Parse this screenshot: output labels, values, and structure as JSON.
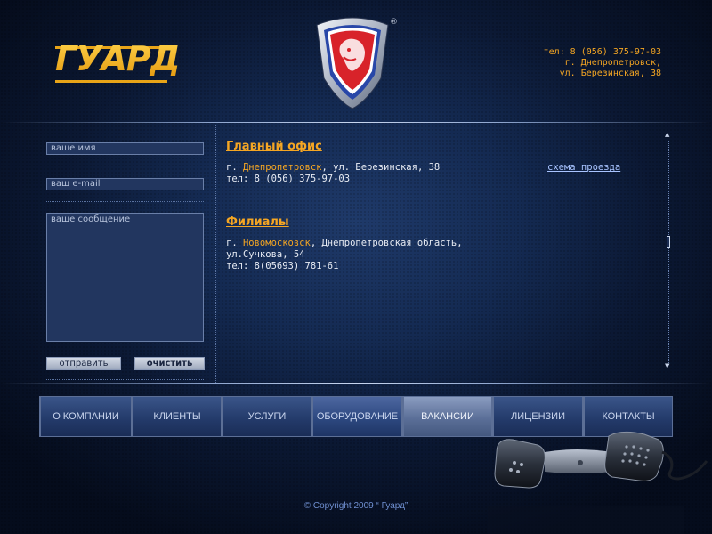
{
  "header": {
    "logo_text": "ГУАРД",
    "registered": "®",
    "contact": {
      "phone": "тел: 8 (056) 375-97-03",
      "city": "г. Днепропетровск,",
      "street": "ул. Березинская, 38"
    }
  },
  "form": {
    "name_placeholder": "ваше имя",
    "email_placeholder": "ваш e-mail",
    "message_placeholder": "ваше сообщение",
    "send_label": "отправить",
    "clear_label": "очистить"
  },
  "content": {
    "main_office": {
      "heading": "Главный офис",
      "city_prefix": "г. ",
      "city": "Днепропетровск",
      "address_rest": ", ул. Березинская, 38",
      "phone": "тел: 8 (056) 375-97-03",
      "map_link": "схема проезда"
    },
    "branches": {
      "heading": "Филиалы",
      "city_prefix": "г. ",
      "city": "Новомосковск",
      "address_rest": ", Днепропетровская область,",
      "street": "ул.Сучкова, 54",
      "phone": "тел: 8(05693) 781-61"
    }
  },
  "nav": {
    "items": [
      {
        "label": "О КОМПАНИИ"
      },
      {
        "label": "КЛИЕНТЫ"
      },
      {
        "label": "УСЛУГИ"
      },
      {
        "label": "ОБОРУДОВАНИЕ"
      },
      {
        "label": "ВАКАНСИИ"
      },
      {
        "label": "ЛИЦЕНЗИИ"
      },
      {
        "label": "КОНТАКТЫ"
      }
    ],
    "active_label": "ВАКАНСИИ"
  },
  "footer": {
    "copyright": "© Copyright 2009 “ Гуард”"
  },
  "colors": {
    "accent": "#f5a623",
    "link": "#a9c4ff",
    "background": "#142a52"
  },
  "icons": [
    "shield-logo-icon",
    "scroll-up-arrow-icon",
    "scroll-down-arrow-icon",
    "telephone-handset-icon"
  ]
}
